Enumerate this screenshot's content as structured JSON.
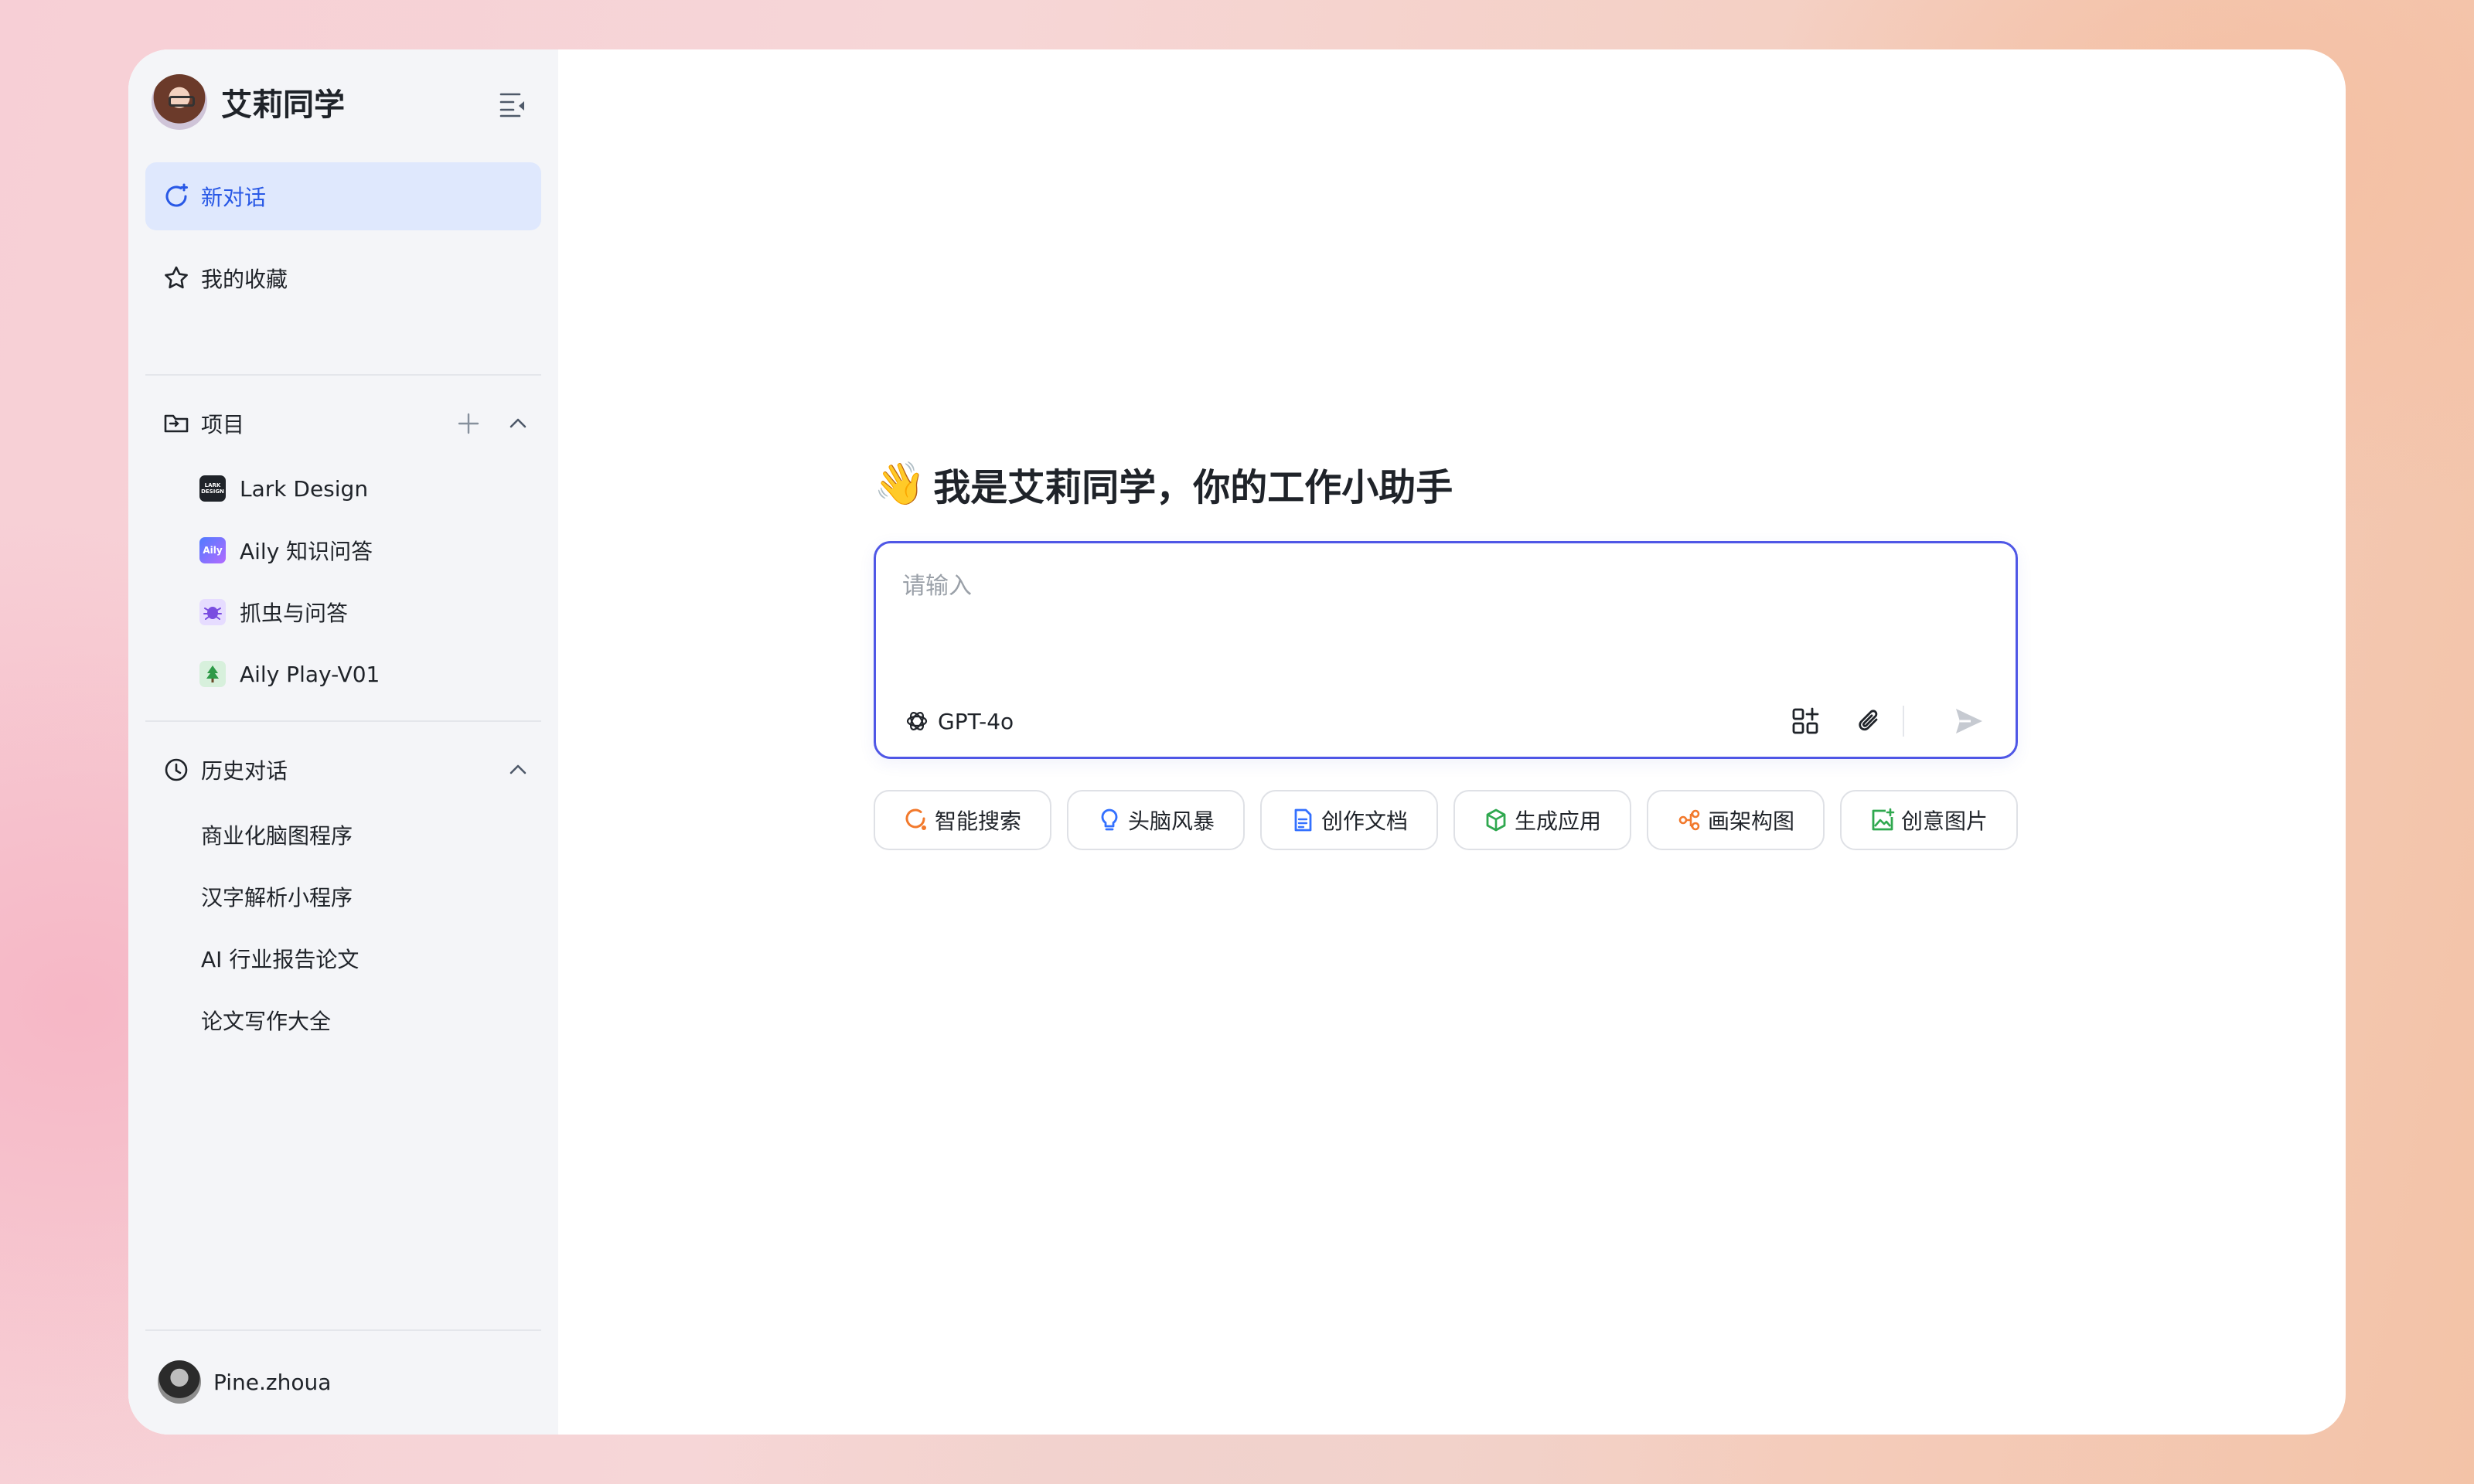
{
  "app": {
    "name": "艾莉同学"
  },
  "sidebar": {
    "new_chat": "新对话",
    "favorites": "我的收藏",
    "projects": {
      "title": "项目",
      "items": [
        {
          "label": "Lark Design",
          "icon": "lark-design-icon",
          "icon_text": "LARK DESIGN"
        },
        {
          "label": "Aily 知识问答",
          "icon": "aily-icon",
          "icon_text": "Aily"
        },
        {
          "label": "抓虫与问答",
          "icon": "bug-icon"
        },
        {
          "label": "Aily Play-V01",
          "icon": "tree-icon"
        }
      ]
    },
    "history": {
      "title": "历史对话",
      "items": [
        {
          "label": "商业化脑图程序"
        },
        {
          "label": "汉字解析小程序"
        },
        {
          "label": "AI 行业报告论文"
        },
        {
          "label": "论文写作大全"
        }
      ]
    },
    "user": {
      "name": "Pine.zhoua"
    }
  },
  "main": {
    "greeting": "我是艾莉同学，你的工作小助手",
    "greeting_emoji": "👋",
    "input": {
      "placeholder": "请输入",
      "model": "GPT-4o"
    },
    "suggestions": [
      {
        "label": "智能搜索",
        "icon": "search-refresh-icon",
        "color": "#f2792c"
      },
      {
        "label": "头脑风暴",
        "icon": "lightbulb-icon",
        "color": "#3370ff"
      },
      {
        "label": "创作文档",
        "icon": "document-icon",
        "color": "#3370ff"
      },
      {
        "label": "生成应用",
        "icon": "cube-icon",
        "color": "#2fa84f"
      },
      {
        "label": "画架构图",
        "icon": "diagram-icon",
        "color": "#f2792c"
      },
      {
        "label": "创意图片",
        "icon": "image-icon",
        "color": "#2fa84f"
      }
    ]
  },
  "colors": {
    "accent": "#2858e6",
    "active_bg": "#dfe8fd",
    "composer_border": "#4f57e6",
    "sidebar_bg": "#f4f5f8"
  }
}
